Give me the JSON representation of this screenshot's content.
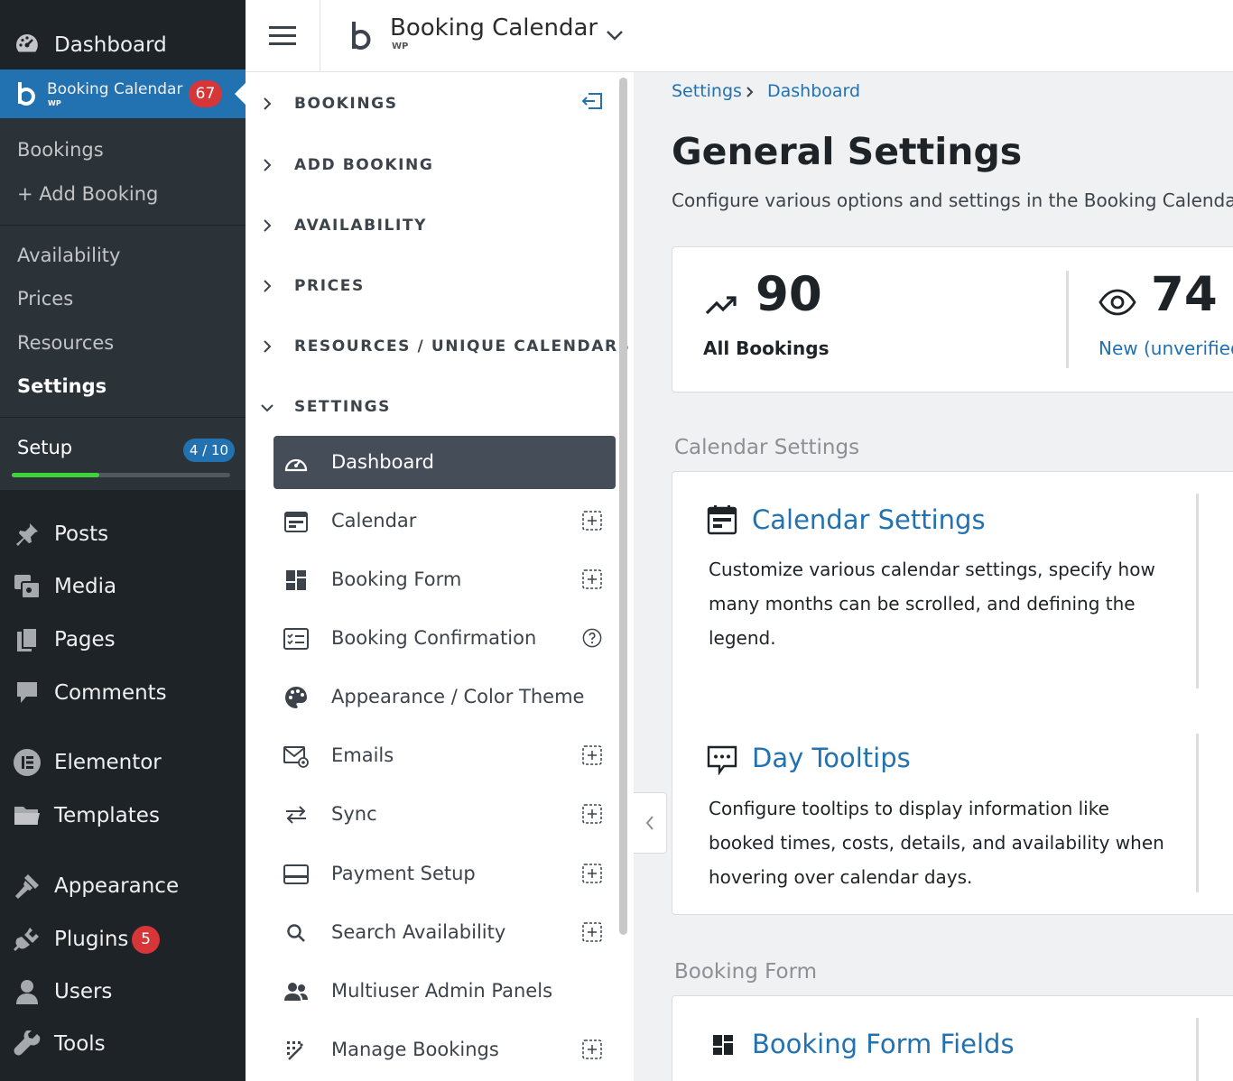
{
  "wp_sidebar": {
    "dashboard": "Dashboard",
    "booking_calendar": {
      "label": "Booking Calendar",
      "sub": "WP",
      "badge": "67"
    },
    "submenu": {
      "bookings": "Bookings",
      "add_booking": "+ Add Booking",
      "availability": "Availability",
      "prices": "Prices",
      "resources": "Resources",
      "settings": "Settings",
      "setup_label": "Setup",
      "setup_badge": "4 / 10",
      "setup_progress": 0.4
    },
    "menu": {
      "posts": "Posts",
      "media": "Media",
      "pages": "Pages",
      "comments": "Comments",
      "elementor": "Elementor",
      "templates": "Templates",
      "appearance": "Appearance",
      "plugins": "Plugins",
      "plugins_badge": "5",
      "users": "Users",
      "tools": "Tools"
    }
  },
  "topbar": {
    "title": "Booking Calendar",
    "sub": "WP"
  },
  "plugin_nav": {
    "groups": {
      "bookings": "BOOKINGS",
      "add_booking": "ADD BOOKING",
      "availability": "AVAILABILITY",
      "prices": "PRICES",
      "resources": "RESOURCES / UNIQUE CALENDARS",
      "settings": "SETTINGS"
    },
    "items": {
      "dashboard": "Dashboard",
      "calendar": "Calendar",
      "booking_form": "Booking Form",
      "booking_confirmation": "Booking Confirmation",
      "appearance": "Appearance / Color Theme",
      "emails": "Emails",
      "sync": "Sync",
      "payment_setup": "Payment Setup",
      "search_availability": "Search Availability",
      "multiuser": "Multiuser Admin Panels",
      "manage_bookings": "Manage Bookings"
    }
  },
  "main": {
    "breadcrumb": {
      "settings": "Settings",
      "dashboard": "Dashboard"
    },
    "title": "General Settings",
    "description": "Configure various options and settings in the Booking Calendar",
    "stats": {
      "all_value": "90",
      "all_label": "All Bookings",
      "new_value": "74",
      "new_label": "New (unverified"
    },
    "calendar_section": "Calendar Settings",
    "calendar_settings_title": "Calendar Settings",
    "calendar_settings_desc": "Customize various calendar settings, specify how many months can be scrolled, and defining the legend.",
    "day_tooltips_title": "Day Tooltips",
    "day_tooltips_desc": "Configure tooltips to display information like booked times, costs, details, and availability when hovering over calendar days.",
    "booking_form_section": "Booking Form",
    "booking_form_fields_title": "Booking Form Fields"
  },
  "colors": {
    "wp_sidebar_bg": "#1d2327",
    "wp_accent": "#2271b1",
    "badge_red": "#d63638",
    "progress_green": "#3fd33a",
    "active_nav_bg": "#454d58"
  }
}
